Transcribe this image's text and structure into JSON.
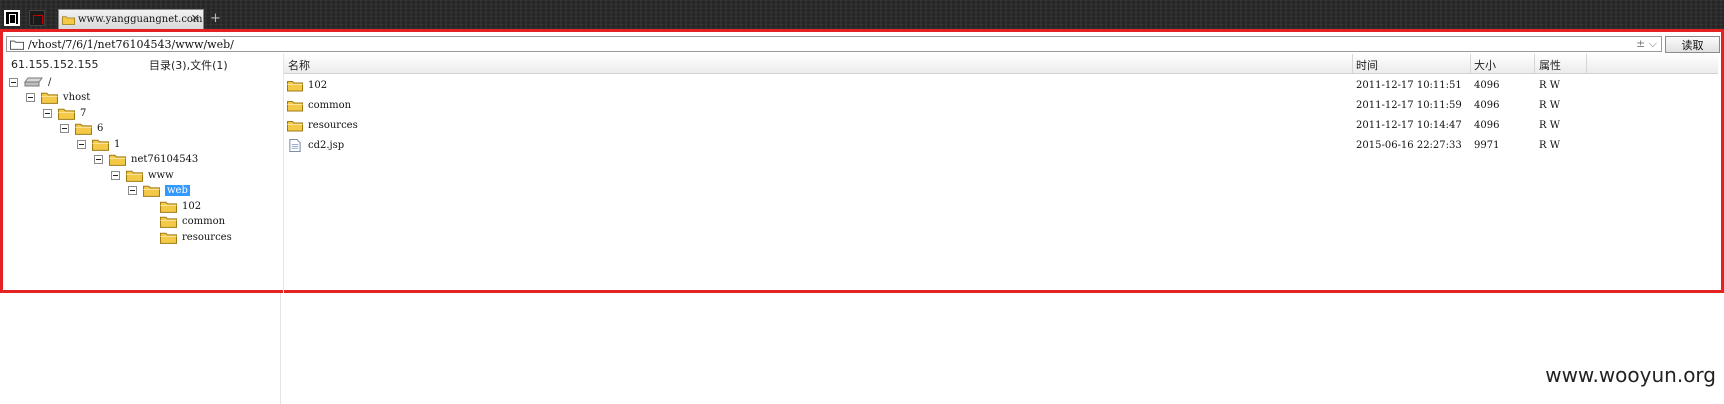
{
  "tab": {
    "title": "www.yangguangnet.com",
    "close": "✕"
  },
  "new_tab": "+",
  "address": {
    "path": "/vhost/7/6/1/net76104543/www/web/",
    "extra": "± ⌵"
  },
  "read_button": "读取",
  "left_header": {
    "ip": "61.155.152.155",
    "summary": "目录(3),文件(1)"
  },
  "tree": [
    {
      "label": "/",
      "icon": "drive-icon",
      "expander": true,
      "selected": false
    },
    {
      "label": "vhost",
      "icon": "folder-icon",
      "expander": true,
      "selected": false
    },
    {
      "label": "7",
      "icon": "folder-icon",
      "expander": true,
      "selected": false
    },
    {
      "label": "6",
      "icon": "folder-icon",
      "expander": true,
      "selected": false
    },
    {
      "label": "1",
      "icon": "folder-icon",
      "expander": true,
      "selected": false
    },
    {
      "label": "net76104543",
      "icon": "folder-icon",
      "expander": true,
      "selected": false
    },
    {
      "label": "www",
      "icon": "folder-icon",
      "expander": true,
      "selected": false
    },
    {
      "label": "web",
      "icon": "folder-icon",
      "expander": true,
      "selected": true
    },
    {
      "label": "102",
      "icon": "folder-icon",
      "expander": false,
      "selected": false
    },
    {
      "label": "common",
      "icon": "folder-icon",
      "expander": false,
      "selected": false
    },
    {
      "label": "resources",
      "icon": "folder-icon",
      "expander": false,
      "selected": false
    }
  ],
  "columns": {
    "name": "名称",
    "time": "时间",
    "size": "大小",
    "attr": "属性"
  },
  "files": [
    {
      "name": "102",
      "time": "2011-12-17 10:11:51",
      "size": "4096",
      "attr": "R W",
      "type": "folder-icon"
    },
    {
      "name": "common",
      "time": "2011-12-17 10:11:59",
      "size": "4096",
      "attr": "R W",
      "type": "folder-icon"
    },
    {
      "name": "resources",
      "time": "2011-12-17 10:14:47",
      "size": "4096",
      "attr": "R W",
      "type": "folder-icon"
    },
    {
      "name": "cd2.jsp",
      "time": "2015-06-16 22:27:33",
      "size": "9971",
      "attr": "R W",
      "type": "file-icon"
    }
  ],
  "watermark": "www.wooyun.org",
  "colors": {
    "highlight_border": "#e52222",
    "selection": "#3399ff",
    "folder": "#f2c744"
  }
}
